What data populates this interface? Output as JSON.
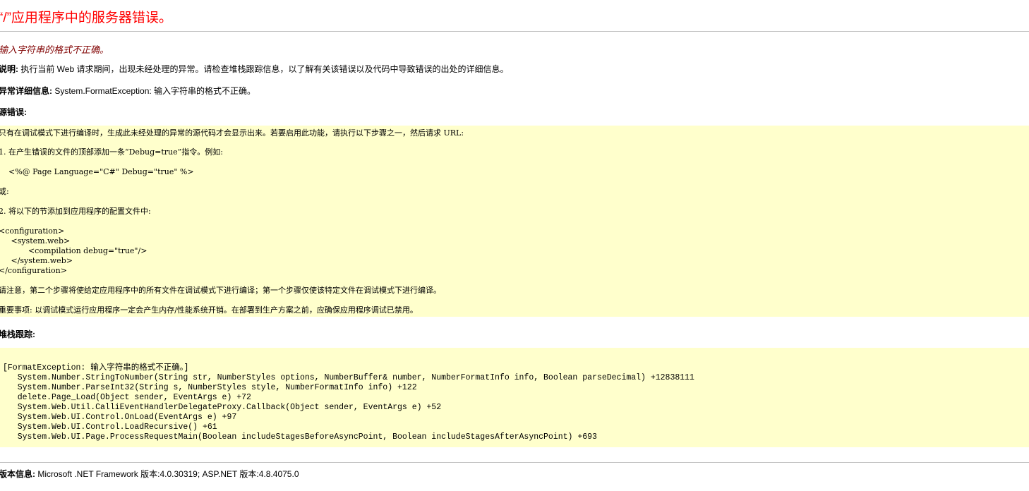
{
  "title": "“/”应用程序中的服务器错误。",
  "subtitle": "输入字符串的格式不正确。",
  "description": {
    "label": "说明:",
    "text": " 执行当前 Web 请求期间，出现未经处理的异常。请检查堆栈跟踪信息，以了解有关该错误以及代码中导致错误的出处的详细信息。"
  },
  "exception": {
    "label": "异常详细信息:",
    "text": " System.FormatException: 输入字符串的格式不正确。"
  },
  "source_error": {
    "label": "源错误:",
    "intro": "只有在调试模式下进行编译时，生成此未经处理的异常的源代码才会显示出来。若要启用此功能，请执行以下步骤之一，然后请求 URL:",
    "step1": "1. 在产生错误的文件的顶部添加一条“Debug=true”指令。例如:",
    "step1_code": "    <%@ Page Language=\"C#\" Debug=\"true\" %>",
    "or": "或:",
    "step2": "2. 将以下的节添加到应用程序的配置文件中:",
    "config_code": "<configuration>\n     <system.web>\n            <compilation debug=\"true\"/>\n     </system.web>\n</configuration>",
    "note": "请注意，第二个步骤将使给定应用程序中的所有文件在调试模式下进行编译；第一个步骤仅使该特定文件在调试模式下进行编译。",
    "important": "重要事项: 以调试模式运行应用程序一定会产生内存/性能系统开销。在部署到生产方案之前，应确保应用程序调试已禁用。"
  },
  "stack_trace": {
    "label": "堆栈跟踪:",
    "text": "[FormatException: 输入字符串的格式不正确。]\n   System.Number.StringToNumber(String str, NumberStyles options, NumberBuffer& number, NumberFormatInfo info, Boolean parseDecimal) +12838111\n   System.Number.ParseInt32(String s, NumberStyles style, NumberFormatInfo info) +122\n   delete.Page_Load(Object sender, EventArgs e) +72\n   System.Web.Util.CalliEventHandlerDelegateProxy.Callback(Object sender, EventArgs e) +52\n   System.Web.UI.Control.OnLoad(EventArgs e) +97\n   System.Web.UI.Control.LoadRecursive() +61\n   System.Web.UI.Page.ProcessRequestMain(Boolean includeStagesBeforeAsyncPoint, Boolean includeStagesAfterAsyncPoint) +693"
  },
  "version": {
    "label": "版本信息:",
    "text": " Microsoft .NET Framework 版本:4.0.30319; ASP.NET 版本:4.8.4075.0"
  },
  "colors": {
    "title": "#ff0000",
    "subtitle": "#800000",
    "code_bg": "#ffffcc",
    "rule": "#c0c0c0"
  }
}
